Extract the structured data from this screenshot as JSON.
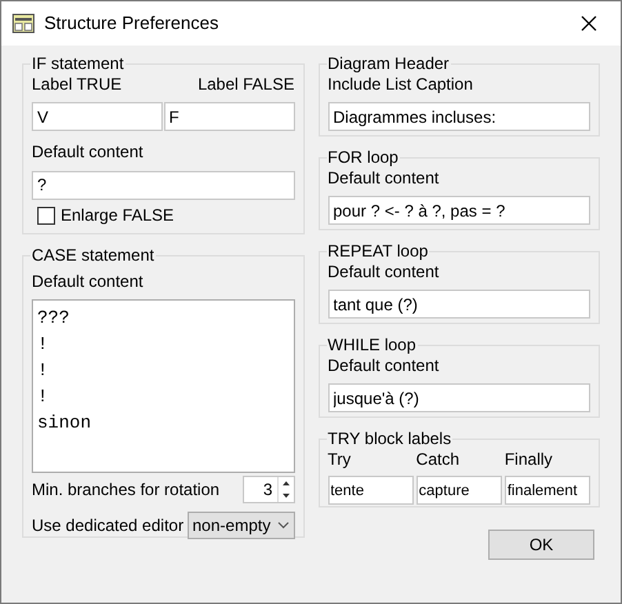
{
  "window": {
    "title": "Structure Preferences"
  },
  "if_statement": {
    "title": "IF statement",
    "label_true": {
      "label": "Label TRUE",
      "value": "V"
    },
    "label_false": {
      "label": "Label FALSE",
      "value": "F"
    },
    "default_content": {
      "label": "Default content",
      "value": "?"
    },
    "enlarge_false": {
      "label": "Enlarge FALSE",
      "checked": false
    }
  },
  "case_statement": {
    "title": "CASE statement",
    "default_content": {
      "label": "Default content",
      "lines": [
        "???",
        "!",
        "!",
        "!",
        "sinon"
      ]
    },
    "min_branches": {
      "label": "Min. branches for rotation",
      "value": "3"
    },
    "dedicated_editor": {
      "label": "Use dedicated editor",
      "value": "non-empty"
    }
  },
  "right_groups": [
    {
      "title": "Diagram Header",
      "label": "Include List Caption",
      "value": "Diagrammes incluses:"
    },
    {
      "title": "FOR loop",
      "label": "Default content",
      "value": "pour ? <- ? à ?, pas = ?"
    },
    {
      "title": "REPEAT loop",
      "label": "Default content",
      "value": "tant que (?)"
    },
    {
      "title": "WHILE loop",
      "label": "Default content",
      "value": "jusque'à (?)"
    }
  ],
  "try_block": {
    "title": "TRY block labels",
    "fields": [
      {
        "label": "Try",
        "value": "tente"
      },
      {
        "label": "Catch",
        "value": "capture"
      },
      {
        "label": "Finally",
        "value": "finalement"
      }
    ]
  },
  "buttons": [
    {
      "label": "OK"
    }
  ]
}
